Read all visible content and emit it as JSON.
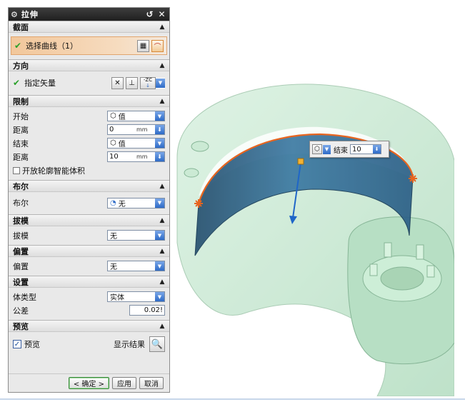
{
  "dialog": {
    "title": "拉伸",
    "sections": {
      "section": {
        "title": "截面",
        "select_curve_label": "选择曲线（1）"
      },
      "direction": {
        "title": "方向",
        "vector_label": "指定矢量",
        "vector_option": "-ZC"
      },
      "limits": {
        "title": "限制",
        "start_label": "开始",
        "start_value": "值",
        "start_distance_label": "距离",
        "start_distance": "0",
        "end_label": "结束",
        "end_value": "值",
        "end_distance_label": "距离",
        "end_distance": "10",
        "unit": "mm",
        "open_profile_label": "开放轮廓智能体积"
      },
      "boolean": {
        "title": "布尔",
        "label": "布尔",
        "value": "无"
      },
      "draft": {
        "title": "拔模",
        "label": "拔模",
        "value": "无"
      },
      "offset": {
        "title": "偏置",
        "label": "偏置",
        "value": "无"
      },
      "settings": {
        "title": "设置",
        "body_type_label": "体类型",
        "body_type_value": "实体",
        "tolerance_label": "公差",
        "tolerance_value": "0.02!"
      },
      "preview": {
        "title": "预览",
        "preview_label": "预览",
        "show_result_label": "显示结果"
      }
    },
    "buttons": {
      "ok": "< 确定 >",
      "apply": "应用",
      "cancel": "取消"
    }
  },
  "viewport": {
    "float_toolbar": {
      "end_label": "结束",
      "end_value": "10"
    }
  },
  "colors": {
    "model_fill": "#b9dfc6",
    "sheet_fill": "#2f6f9a",
    "curve_highlight": "#e8651f",
    "vector_arrow": "#1f66c8"
  }
}
